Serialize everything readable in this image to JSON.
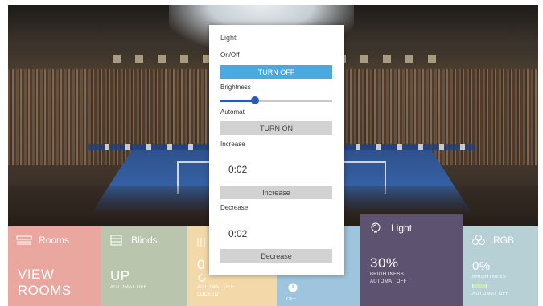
{
  "popup": {
    "title": "Light",
    "onoff_label": "On/Off",
    "turn_off_label": "TURN OFF",
    "brightness_label": "Brightness",
    "brightness_level": 0.31,
    "automat_label": "Automat",
    "turn_on_label": "TURN ON",
    "increase_label": "Increase",
    "increase_value": "0:02",
    "increase_button": "Increase",
    "decrease_label": "Decrease",
    "decrease_value": "0:02",
    "decrease_button": "Decrease"
  },
  "tiles": {
    "rooms": {
      "title": "Rooms",
      "big_line1": "VIEW",
      "big_line2": "ROOMS",
      "color": "#eaa79f"
    },
    "blinds": {
      "title": "Blinds",
      "big": "UP",
      "status": "AUTOMAT OFF",
      "color": "#b9c5ac"
    },
    "heating": {
      "big": "0",
      "status": "AUTOMAT OFF",
      "status2": "LOCKED",
      "color": "#f3d9a9"
    },
    "clock": {
      "status": "OFF",
      "color": "#9ec4de"
    },
    "light": {
      "title": "Light",
      "big": "30%",
      "status": "BRIGHTNESS",
      "status2": "AUTOMAT OFF",
      "color": "#5e5271"
    },
    "rgb": {
      "title": "RGB",
      "big": "0%",
      "status": "BRIGHTNESS",
      "status2": "AUTOMAT OFF",
      "color": "#b7d0d6",
      "swatch": "#c4e8b8"
    }
  },
  "colors": {
    "accent": "#4aa9e1",
    "slider": "#2c58b8"
  }
}
